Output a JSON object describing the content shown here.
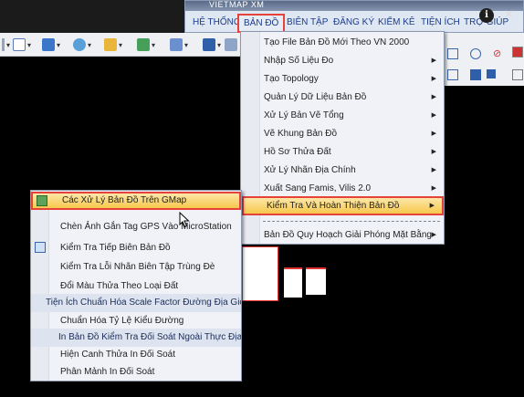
{
  "window": {
    "title": "VIETMAP XM"
  },
  "menubar": {
    "items": [
      "HỆ THỐNG",
      "BẢN ĐỒ",
      "BIÊN TẬP",
      "ĐĂNG KÝ",
      "KIỂM KÊ",
      "TIỆN ÍCH",
      "TRỢ GIÚP"
    ],
    "active": "BẢN ĐỒ"
  },
  "dropdown": {
    "items": [
      {
        "label": "Tạo File Bản Đồ Mới Theo VN 2000",
        "submenu": false
      },
      {
        "label": "Nhập Số Liệu Đo",
        "submenu": true
      },
      {
        "label": "Tạo Topology",
        "submenu": true
      },
      {
        "label": "Quản Lý Dữ Liệu Bản Đồ",
        "submenu": true
      },
      {
        "label": "Xử Lý Bản Vẽ Tổng",
        "submenu": true
      },
      {
        "label": "Vẽ Khung Bản Đồ",
        "submenu": true
      },
      {
        "label": "Hồ Sơ Thửa Đất",
        "submenu": true
      },
      {
        "label": "Xử Lý Nhãn Địa Chính",
        "submenu": true
      },
      {
        "label": "Xuất Sang Famis, Vilis 2.0",
        "submenu": true
      },
      {
        "label": "Kiểm Tra Và Hoàn Thiện Bản Đồ",
        "submenu": true,
        "highlighted": true
      },
      {
        "label": "Bản Đồ Quy Hoạch Giải Phóng Mặt Bằng",
        "submenu": true
      }
    ]
  },
  "submenu": {
    "items": [
      {
        "label": "Các Xử Lý Bản Đồ Trên GMap",
        "highlighted": true
      },
      {
        "label": "Chèn Ảnh Gắn Tag GPS Vào MicroStation"
      },
      {
        "label": "Kiểm Tra Tiếp Biên Bản Đồ"
      },
      {
        "label": "Kiểm Tra Lỗi Nhãn Biên Tập Trùng Đè"
      },
      {
        "label": "Đổi Màu Thửa Theo Loại Đất"
      },
      {
        "label": "Tiện Ích Chuẩn Hóa Scale Factor Đường Địa Giới..."
      },
      {
        "label": "Chuẩn Hóa Tỷ Lệ Kiểu Đường"
      },
      {
        "label": "In Bản Đồ Kiểm Tra Đối Soát Ngoài Thực Địa"
      },
      {
        "label": "Hiện Canh Thửa In Đối Soát"
      },
      {
        "label": "Phân Mảnh In Đối Soát"
      }
    ]
  },
  "glyphs": {
    "info": "i",
    "close": "✕",
    "arrow": "▶",
    "caret": "▾"
  },
  "colors": {
    "highlight_border": "#e5423b",
    "highlight_fill": "#f6c84c",
    "menu_text": "#1b3c8c"
  }
}
